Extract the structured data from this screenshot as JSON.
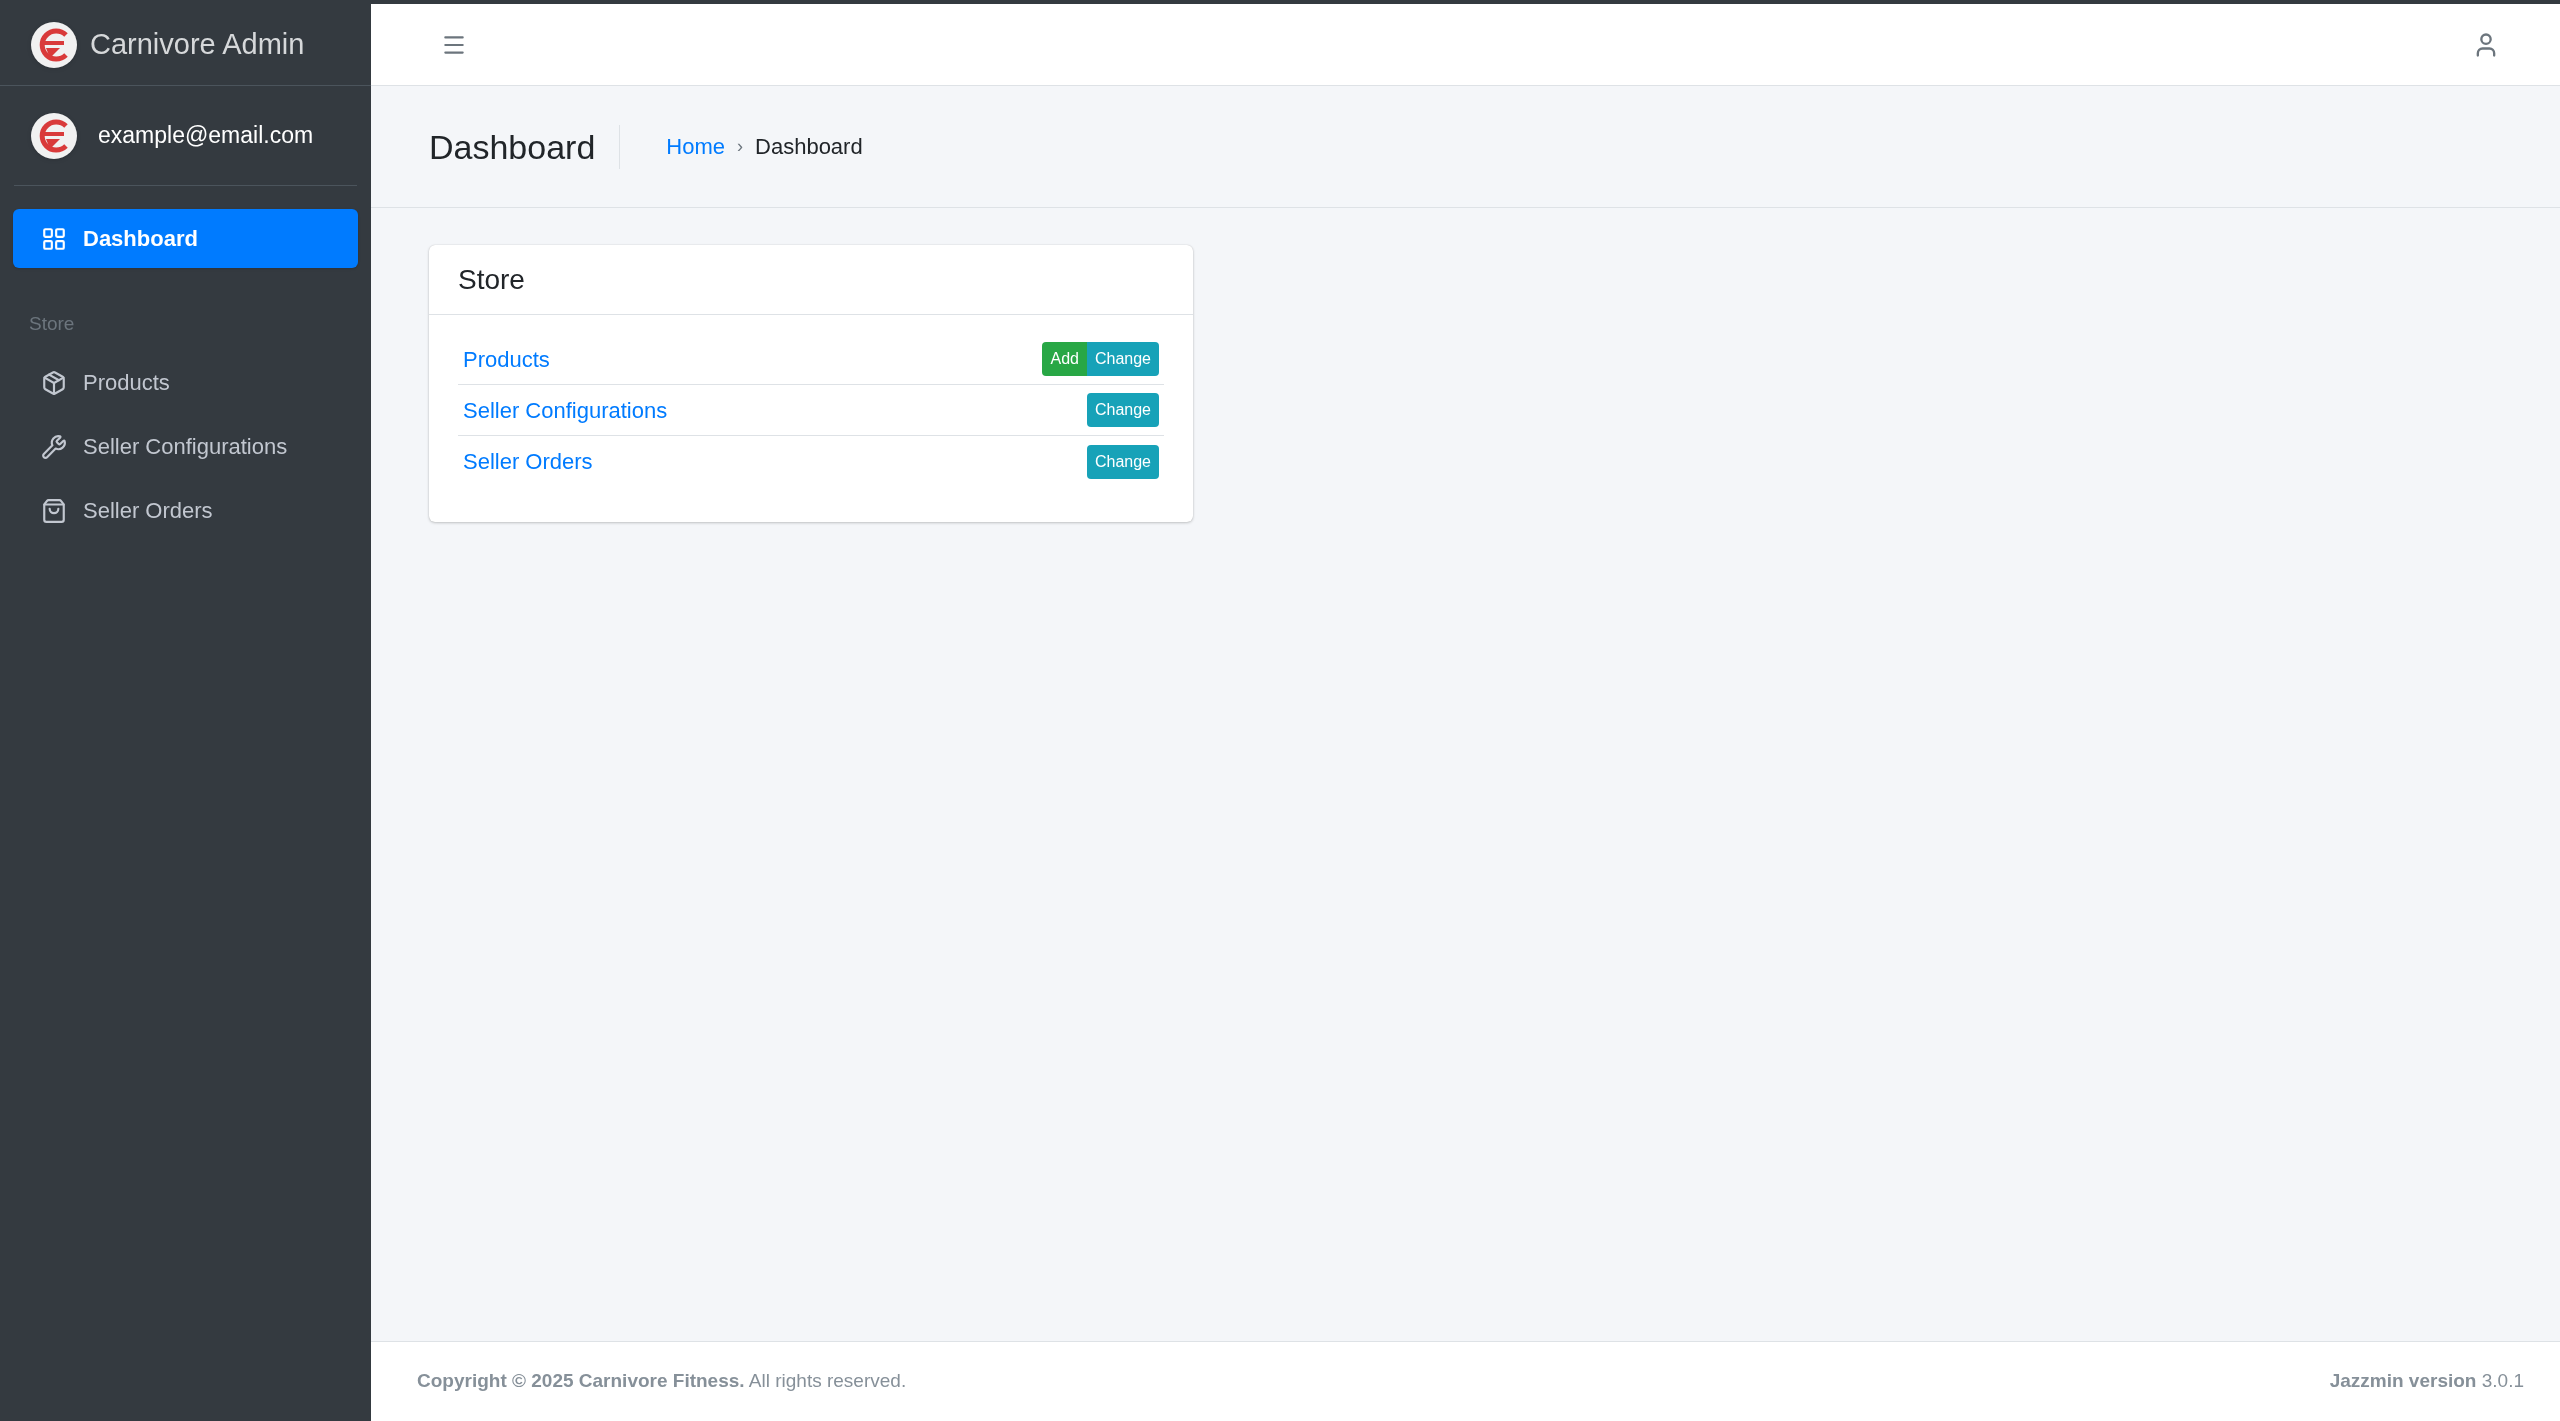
{
  "sidebar": {
    "brand": "Carnivore Admin",
    "user": "example@email.com",
    "items": [
      {
        "label": "Dashboard",
        "selected": true
      }
    ],
    "section": "Store",
    "store_items": [
      {
        "label": "Products",
        "selected": false
      },
      {
        "label": "Seller Configurations",
        "selected": false
      },
      {
        "label": "Seller Orders",
        "selected": false
      }
    ]
  },
  "header": {
    "title": "Dashboard",
    "breadcrumb": [
      {
        "label": "Home",
        "kind": "link"
      },
      {
        "label": "›",
        "kind": "separator"
      },
      {
        "label": "Dashboard",
        "kind": "current"
      }
    ]
  },
  "card": {
    "title": "Store",
    "rows": [
      {
        "label": "Products",
        "buttons": [
          {
            "label": "Add",
            "kind": "add"
          },
          {
            "label": "Change",
            "kind": "change"
          }
        ]
      },
      {
        "label": "Seller Configurations",
        "buttons": [
          {
            "label": "Change",
            "kind": "change"
          }
        ]
      },
      {
        "label": "Seller Orders",
        "buttons": [
          {
            "label": "Change",
            "kind": "change"
          }
        ]
      }
    ]
  },
  "footer": {
    "copyright": "**Copyright © 2025 Carnivore Fitness.** All rights reserved.",
    "version": "**Jazzmin version** 3.0.1"
  }
}
